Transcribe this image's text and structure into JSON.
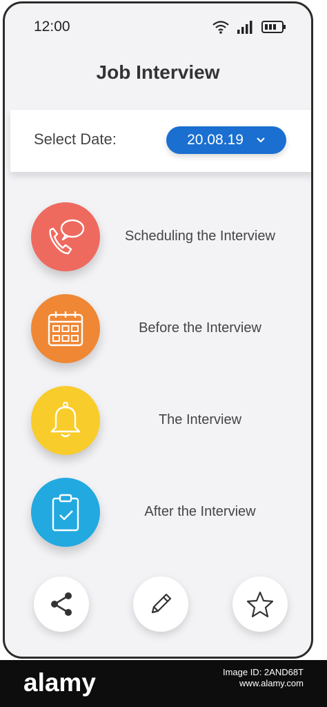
{
  "status_bar": {
    "time": "12:00",
    "wifi_icon": "wifi-icon",
    "signal_icon": "signal-icon",
    "battery_icon": "battery-icon"
  },
  "header": {
    "title": "Job Interview"
  },
  "date_selector": {
    "label": "Select Date:",
    "value": "20.08.19",
    "icon": "chevron-down-icon",
    "color": "#1a6fd0"
  },
  "menu": [
    {
      "label": "Scheduling the Interview",
      "icon": "phone-chat-icon",
      "color": "#ee6a5f"
    },
    {
      "label": "Before the Interview",
      "icon": "calendar-icon",
      "color": "#ef8734"
    },
    {
      "label": "The Interview",
      "icon": "bell-icon",
      "color": "#f8cc2b"
    },
    {
      "label": "After the Interview",
      "icon": "clipboard-check-icon",
      "color": "#22a9e0"
    }
  ],
  "actions": [
    {
      "name": "share",
      "icon": "share-icon"
    },
    {
      "name": "edit",
      "icon": "pencil-icon"
    },
    {
      "name": "favorite",
      "icon": "star-icon"
    }
  ],
  "watermark": {
    "logo": "alamy",
    "line1": "Image ID: 2AND68T",
    "line2": "www.alamy.com"
  }
}
